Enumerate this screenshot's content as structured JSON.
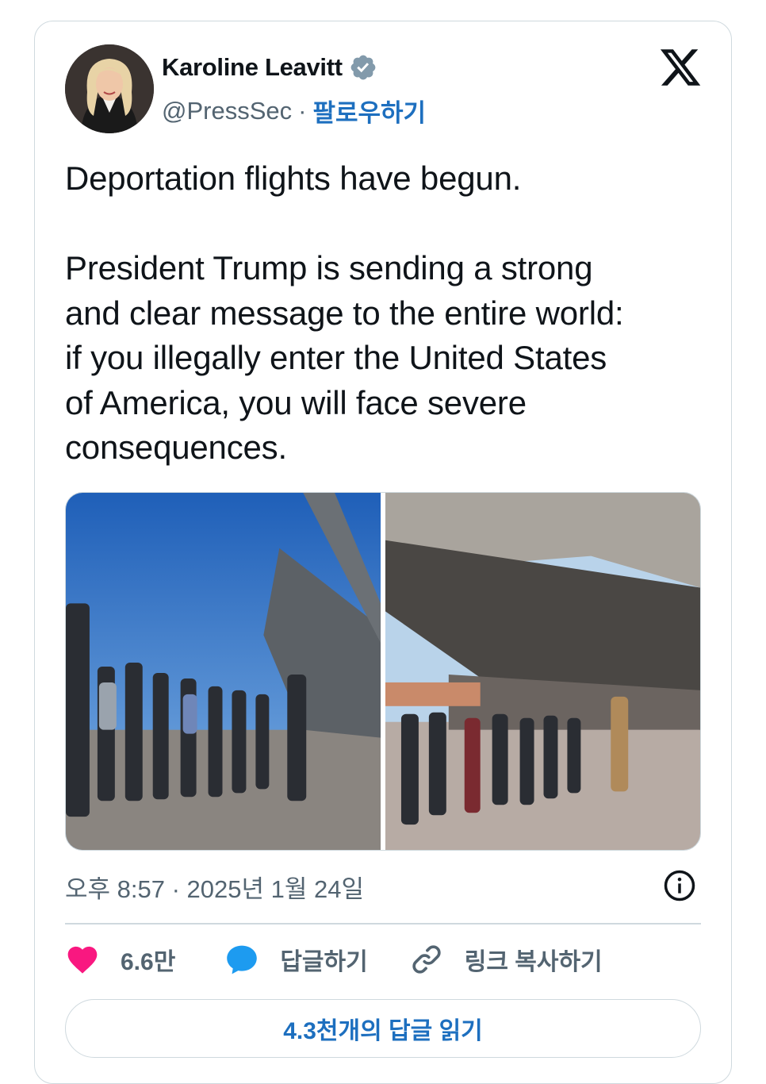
{
  "author": {
    "name": "Karoline Leavitt",
    "handle": "@PressSec",
    "separator": "·",
    "follow_label": "팔로우하기",
    "verified": true,
    "verified_color": "#829aab"
  },
  "platform_logo": "x-logo",
  "tweet": {
    "text": "Deportation flights have begun.\n\nPresident Trump is sending a strong\nand clear message to the entire world:\nif you illegally enter the United States\nof America, you will face severe\nconsequences."
  },
  "media": [
    {
      "description": "photo-1"
    },
    {
      "description": "photo-2"
    }
  ],
  "timestamp": "오후 8:57 · 2025년 1월 24일",
  "actions": {
    "like_count": "6.6만",
    "reply_label": "답글하기",
    "copy_link_label": "링크 복사하기"
  },
  "read_replies_label": "4.3천개의 답글 읽기",
  "colors": {
    "like": "#f91880",
    "reply": "#1d9bf0",
    "link_text": "#1d6fbf",
    "muted": "#536471"
  }
}
